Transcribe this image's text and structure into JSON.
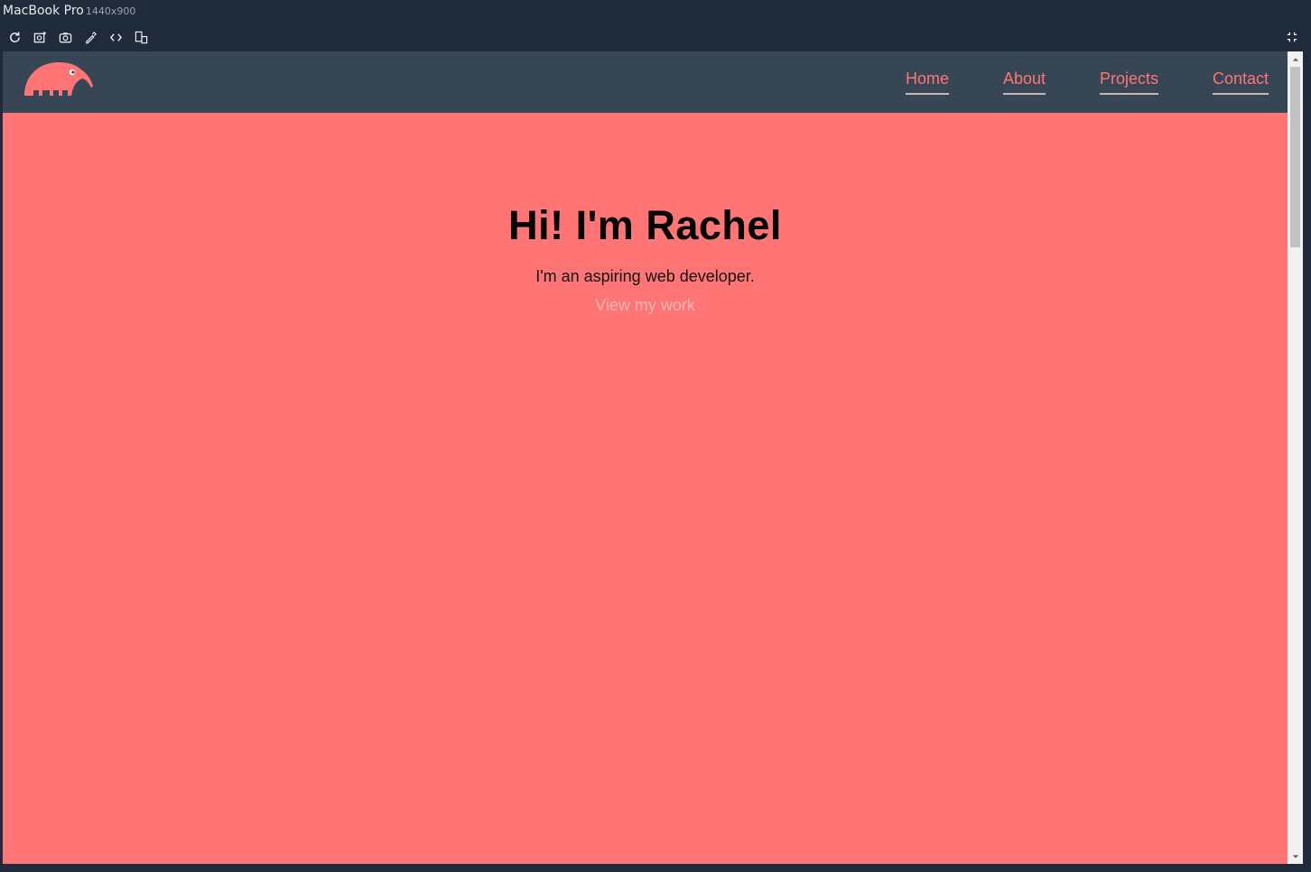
{
  "device": {
    "name": "MacBook Pro",
    "size": "1440x900"
  },
  "toolbar": {
    "icons": [
      "refresh-icon",
      "screenshot-fullpage-icon",
      "camera-icon",
      "eyedropper-icon",
      "code-icon",
      "device-toggle-icon"
    ],
    "collapse_icon": "collapse-icon"
  },
  "site": {
    "logo_icon": "anteater-logo-icon",
    "nav": [
      {
        "label": "Home"
      },
      {
        "label": "About"
      },
      {
        "label": "Projects"
      },
      {
        "label": "Contact"
      }
    ],
    "hero": {
      "title": "Hi! I'm Rachel",
      "subtitle": "I'm an aspiring web developer.",
      "link": "View my work"
    }
  },
  "colors": {
    "header_bg": "#374655",
    "accent": "#ff7575",
    "chrome_bg": "#1f2a3b"
  }
}
